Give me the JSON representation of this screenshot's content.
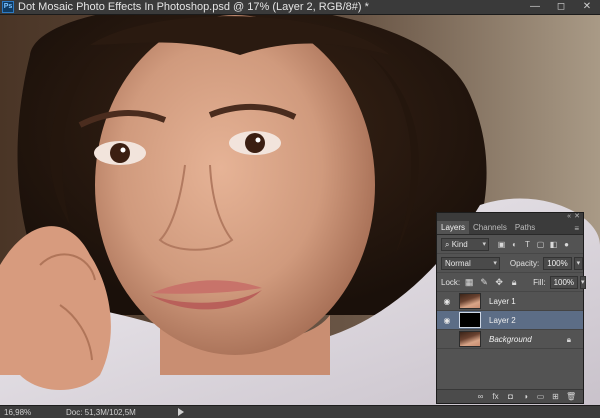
{
  "window": {
    "title": "Dot Mosaic Photo Effects In Photoshop.psd @ 17% (Layer 2, RGB/8#) *",
    "app_icon_label": "Ps",
    "controls": [
      "minimize",
      "maximize",
      "close"
    ],
    "control_glyphs": [
      "—",
      "◻",
      "✕"
    ]
  },
  "status": {
    "zoom": "16,98%",
    "doc": "Doc: 51,3M/102,5M"
  },
  "layers_panel": {
    "collapse_glyph": "«",
    "close_glyph": "✕",
    "menu_glyph": "≡",
    "tabs": [
      "Layers",
      "Channels",
      "Paths"
    ],
    "active_tab": "Layers",
    "filter": {
      "kind_label": "Kind",
      "icons": [
        "image-filter-icon",
        "adjustment-filter-icon",
        "type-filter-icon",
        "shape-filter-icon",
        "smart-object-filter-icon",
        "filter-toggle-icon"
      ]
    },
    "blend_mode": "Normal",
    "opacity_label": "Opacity:",
    "opacity_value": "100%",
    "lock_label": "Lock:",
    "lock_icons": [
      "lock-transparent-icon",
      "lock-image-icon",
      "lock-position-icon",
      "lock-all-icon"
    ],
    "fill_label": "Fill:",
    "fill_value": "100%",
    "layers": [
      {
        "name": "Layer 1",
        "visible": true,
        "thumb": "face",
        "selected": false
      },
      {
        "name": "Layer 2",
        "visible": true,
        "thumb": "black",
        "selected": true
      },
      {
        "name": "Background",
        "visible": false,
        "thumb": "face",
        "selected": false,
        "locked": true
      }
    ],
    "footer_icons": [
      "link-layers-icon",
      "fx-icon",
      "add-mask-icon",
      "adjustment-layer-icon",
      "new-group-icon",
      "new-layer-icon",
      "trash-icon"
    ]
  },
  "colors": {
    "ui_dark": "#2b2b2b",
    "panel_bg": "#535353",
    "selected_layer": "#5c6d86"
  }
}
